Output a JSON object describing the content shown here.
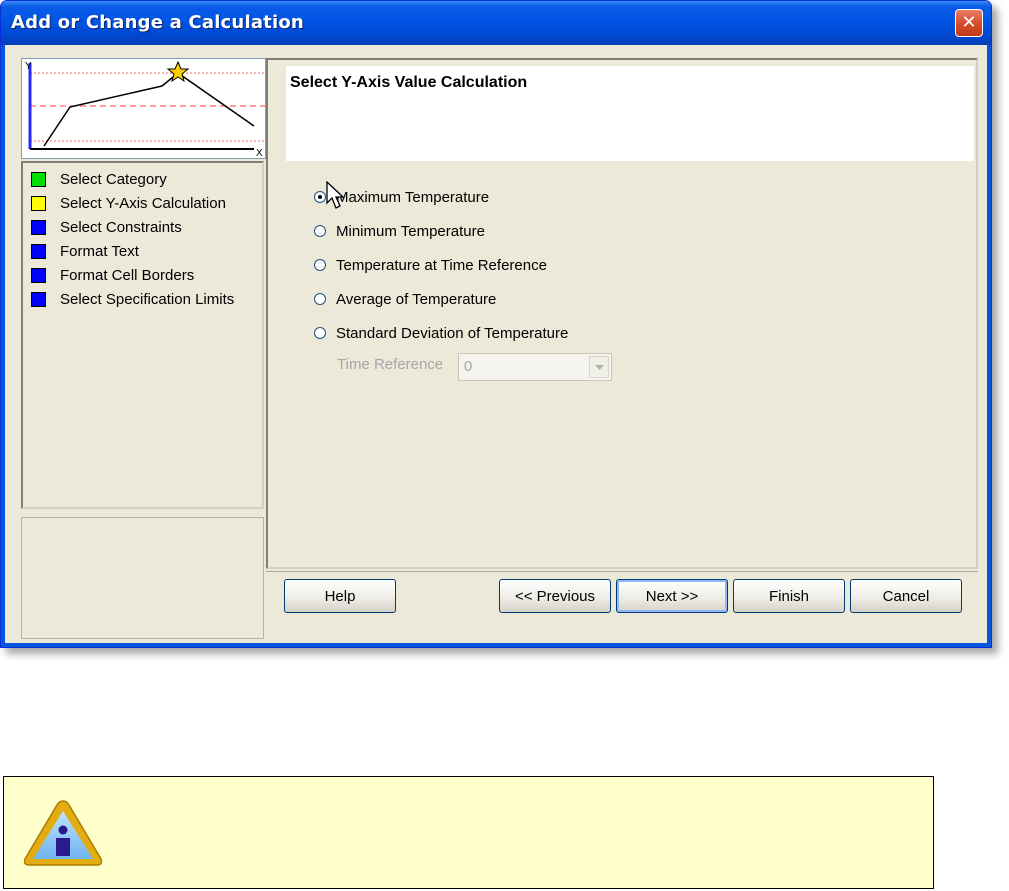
{
  "window": {
    "title": "Add or Change a Calculation",
    "close_label": "✕"
  },
  "preview": {
    "y_axis_letter": "Y",
    "x_axis_letter": "X"
  },
  "steps": [
    {
      "label": "Select Category",
      "color": "#00e000"
    },
    {
      "label": "Select Y-Axis Calculation",
      "color": "#ffff00"
    },
    {
      "label": "Select Constraints",
      "color": "#0000ff"
    },
    {
      "label": "Format Text",
      "color": "#0000ff"
    },
    {
      "label": "Format Cell Borders",
      "color": "#0000ff"
    },
    {
      "label": "Select Specification Limits",
      "color": "#0000ff"
    }
  ],
  "content": {
    "header_title": "Select Y-Axis Value Calculation",
    "options": [
      {
        "label": "Maximum Temperature",
        "checked": true
      },
      {
        "label": "Minimum Temperature",
        "checked": false
      },
      {
        "label": "Temperature at Time Reference",
        "checked": false
      },
      {
        "label": "Average of Temperature",
        "checked": false
      },
      {
        "label": "Standard Deviation of Temperature",
        "checked": false
      }
    ],
    "time_reference_label": "Time Reference",
    "time_reference_value": "0"
  },
  "buttons": {
    "help": "Help",
    "previous": "<< Previous",
    "next": "Next >>",
    "finish": "Finish",
    "cancel": "Cancel"
  }
}
